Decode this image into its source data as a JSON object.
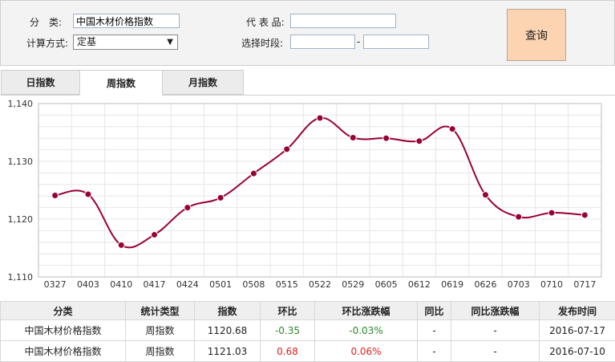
{
  "query": {
    "category_label": "分　类:",
    "category_value": "中国木材价格指数",
    "method_label": "计算方式:",
    "method_value": "定基",
    "product_label": "代 表 品:",
    "product_value": "",
    "period_label": "选择时段:",
    "period_start": "",
    "period_end": "",
    "dash": "-",
    "button_label": "查询"
  },
  "tabs": [
    {
      "label": "日指数",
      "active": false
    },
    {
      "label": "周指数",
      "active": true
    },
    {
      "label": "月指数",
      "active": false
    }
  ],
  "chart_data": {
    "type": "line",
    "categories": [
      "0327",
      "0403",
      "0410",
      "0417",
      "0424",
      "0501",
      "0508",
      "0515",
      "0522",
      "0529",
      "0605",
      "0612",
      "0619",
      "0626",
      "0703",
      "0710",
      "0717"
    ],
    "values": [
      1124.1,
      1124.3,
      1115.5,
      1117.3,
      1122.0,
      1123.7,
      1127.9,
      1132.1,
      1137.5,
      1134.1,
      1134.0,
      1133.5,
      1135.6,
      1124.2,
      1120.4,
      1121.1,
      1120.7
    ],
    "ylim": [
      1110,
      1140
    ],
    "yticks": [
      "1,110",
      "1,120",
      "1,130",
      "1,140"
    ],
    "ytick_values": [
      1110,
      1120,
      1130,
      1140
    ],
    "line_color": "#990033",
    "grid": true
  },
  "table": {
    "headers": [
      "分类",
      "统计类型",
      "指数",
      "环比",
      "环比涨跌幅",
      "同比",
      "同比涨跌幅",
      "发布时间"
    ],
    "rows": [
      [
        "中国木材价格指数",
        "周指数",
        "1120.68",
        "-0.35",
        "-0.03%",
        "-",
        "-",
        "2016-07-17"
      ],
      [
        "中国木材价格指数",
        "周指数",
        "1121.03",
        "0.68",
        "0.06%",
        "-",
        "-",
        "2016-07-10"
      ]
    ],
    "negative_color": "#2a8a2a",
    "positive_color": "#e02020"
  }
}
